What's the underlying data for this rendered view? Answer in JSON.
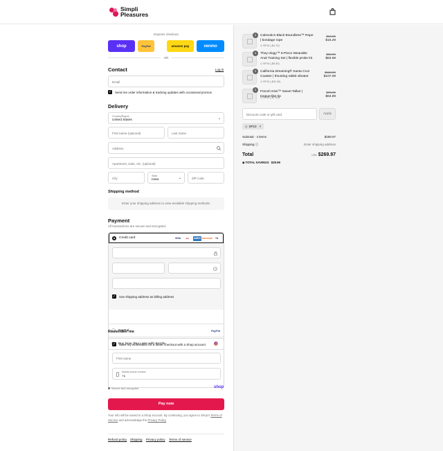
{
  "brand": {
    "name": "Simpli Pleasures"
  },
  "express": {
    "title": "Express checkout",
    "buttons": [
      {
        "label": "shop",
        "color": "#5a31f4",
        "text_color": "#ffffff"
      },
      {
        "label": "PayPal",
        "color": "#ffc439",
        "text_color": "#1f3b7a"
      },
      {
        "label": "amazon pay",
        "color": "#ffd814",
        "text_color": "#111111"
      },
      {
        "label": "venmo",
        "color": "#008cff",
        "text_color": "#ffffff"
      }
    ],
    "or": "OR"
  },
  "contact": {
    "title": "Contact",
    "login": "Log in",
    "email_placeholder": "Email",
    "newsletter_label": "Send me order information & tracking updates with occasional promos"
  },
  "delivery": {
    "title": "Delivery",
    "country_label": "Country/Region",
    "country_value": "United States",
    "first_name": "First name (optional)",
    "last_name": "Last name",
    "address": "Address",
    "apartment": "Apartment, suite, etc. (optional)",
    "city": "City",
    "state_label": "State",
    "state_value": "Iowa",
    "zip": "ZIP code"
  },
  "shipping": {
    "title": "Shipping method",
    "message": "Enter your shipping address to view available shipping methods."
  },
  "payment": {
    "title": "Payment",
    "subtitle": "All transactions are secure and encrypted.",
    "credit_card_label": "Credit card",
    "card_logos": [
      "VISA",
      "MC",
      "AMEX",
      "DISCOVER",
      "+4"
    ],
    "billing_label": "Use shipping address as billing address",
    "paypal_label": "PayPal",
    "paypal_logo": "PayPal",
    "sezzle_label": "Buy Now, Pay Later with Sezzle"
  },
  "remember": {
    "title": "Remember me",
    "save_label": "Save my information for a faster checkout with a Shop account",
    "first_name": "First name",
    "phone_label": "Mobile phone number",
    "phone_value": "+1",
    "secure": "Secure and encrypted",
    "shop": "shop"
  },
  "pay_now": "Pay now",
  "legal": {
    "text_a": "Your info will be saved to a Shop account. By continuing, you agree to Shop's",
    "terms": "Terms of Service",
    "text_b": "and acknowledge the",
    "privacy": "Privacy Policy"
  },
  "footer": [
    "Refund policy",
    "Shipping",
    "Privacy policy",
    "Terms of service"
  ],
  "cart": {
    "items": [
      {
        "qty": "1",
        "name": "Calexotics Black Boundless™ Rope | bondage rope",
        "discount": "SP10 (-$1.70)",
        "old_price": "$16.99",
        "price": "$15.29"
      },
      {
        "qty": "1",
        "name": "They-ology™ 5-Piece Wearable Anal Training Set | flexible probe kit",
        "discount": "SP10 (-$9.30)",
        "old_price": "$92.99",
        "price": "$83.69"
      },
      {
        "qty": "1",
        "name": "California Dreaming® Santa Cruz Coaster | thrusting rabbit vibrator",
        "discount": "SP10 (-$11.90)",
        "old_price": "$118.99",
        "price": "$107.09"
      },
      {
        "qty": "1",
        "name": "French Kiss™ Sweet Talker | tongue-like tip",
        "discount": "SP10 (-$7.00)",
        "old_price": "$70.99",
        "price": "$63.89"
      }
    ],
    "discount_placeholder": "Discount code or gift card",
    "apply": "Apply",
    "applied_code": "SP10",
    "subtotal_label": "Subtotal · 4 items",
    "subtotal_value": "$269.97",
    "shipping_label": "Shipping",
    "shipping_value": "Enter shipping address",
    "total_label": "Total",
    "currency": "USD",
    "total_value": "$269.97",
    "savings_label": "TOTAL SAVINGS",
    "savings_value": "$29.99"
  },
  "colors": {
    "accent": "#e3194d",
    "brand": "#e0155b"
  }
}
